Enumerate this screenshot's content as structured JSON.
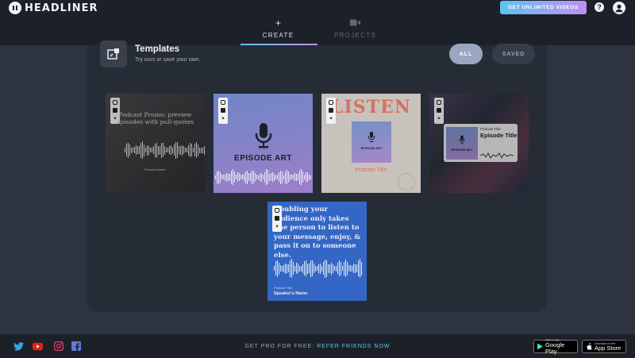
{
  "header": {
    "logo_text": "HEADLINER",
    "cta_label": "GET UNLIMITED VIDEOS",
    "help_glyph": "?"
  },
  "tabs": [
    {
      "icon": "+",
      "label": "CREATE",
      "active": true
    },
    {
      "icon": "video-camera-icon",
      "label": "PROJECTS",
      "active": false
    }
  ],
  "templates_section": {
    "title": "Templates",
    "subtitle": "Try ours or save your own.",
    "filters": [
      {
        "label": "ALL",
        "active": true
      },
      {
        "label": "SAVED",
        "active": false
      }
    ]
  },
  "cards": [
    {
      "headline": "Podcast Promo: preview episodes with pull-quotes",
      "caption": "Podcast Name"
    },
    {
      "headline": "EPISODE ART"
    },
    {
      "headline": "LISTEN",
      "art_label": "EPISODE ART",
      "caption": "Podcast Title"
    },
    {
      "art_label": "EPISODE ART",
      "small_label": "Podcast Title",
      "headline": "Episode Title"
    },
    {
      "headline": "Doubling your audience only takes one person to listen to your message, enjoy, & pass it on to someone else.",
      "small_label": "Podcast Title",
      "caption": "Speaker's Name"
    }
  ],
  "footer": {
    "refer_prefix": "GET PRO FOR FREE:",
    "refer_link": "REFER FRIENDS NOW",
    "google_play": {
      "small": "GET IT ON",
      "big": "Google Play"
    },
    "app_store": {
      "small": "Download on the",
      "big": "App Store"
    },
    "social": [
      "twitter-icon",
      "youtube-icon",
      "instagram-icon",
      "facebook-icon"
    ]
  },
  "colors": {
    "accent_gradient_start": "#5fc3ef",
    "accent_gradient_end": "#c28ef2",
    "topbar": "#1c2129",
    "background": "#2d3440",
    "panel": "#262c36",
    "card_quote_blue": "#3467c5",
    "listen_red": "#d47266"
  }
}
